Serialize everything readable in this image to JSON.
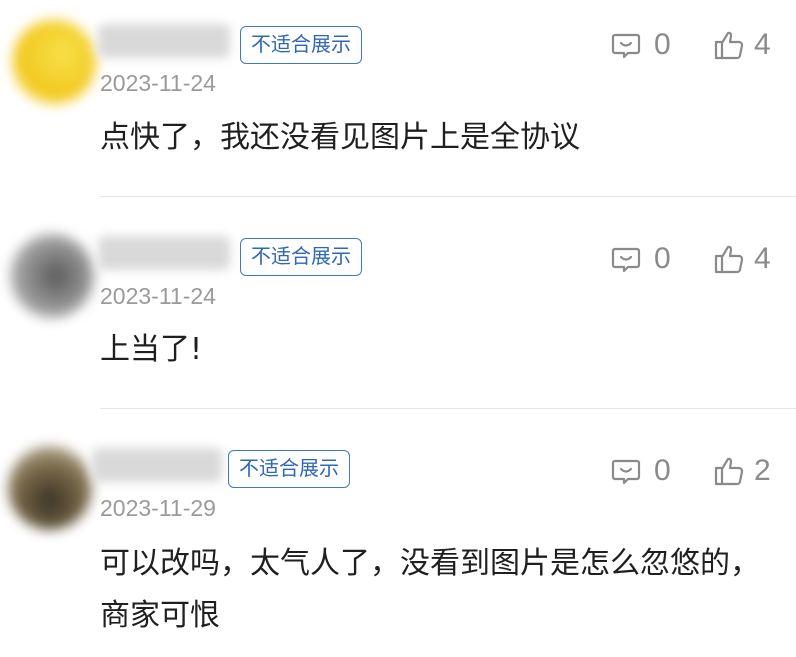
{
  "comments": [
    {
      "tag": "不适合展示",
      "date": "2023-11-24",
      "text": "点快了，我还没看见图片上是全协议",
      "reply_count": "0",
      "like_count": "4",
      "avatar_color": "#f0d43a"
    },
    {
      "tag": "不适合展示",
      "date": "2023-11-24",
      "text": "上当了!",
      "reply_count": "0",
      "like_count": "4",
      "avatar_color": "#8a8a8a"
    },
    {
      "tag": "不适合展示",
      "date": "2023-11-29",
      "text": "可以改吗，太气人了，没看到图片是怎么忽悠的，商家可恨",
      "reply_count": "0",
      "like_count": "2",
      "avatar_color": "#6b5a3a"
    }
  ],
  "icons": {
    "reply": "comment-bubble-icon",
    "like": "thumbs-up-icon"
  }
}
